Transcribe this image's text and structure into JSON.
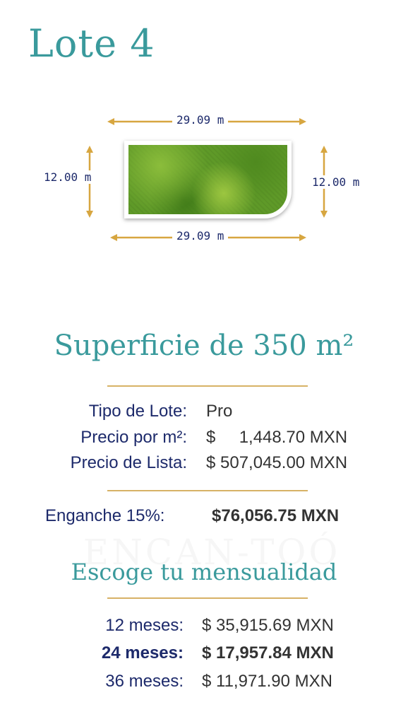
{
  "lot_title": "Lote 4",
  "dimensions": {
    "top": "29.09 m",
    "bottom": "29.09 m",
    "left": "12.00 m",
    "right": "12.00 m"
  },
  "area_title": "Superficie de 350 m²",
  "details": [
    {
      "label": "Tipo de Lote:",
      "value": "Pro"
    },
    {
      "label": "Precio por m²:",
      "value": "$     1,448.70 MXN"
    },
    {
      "label": "Precio de Lista:",
      "value": "$ 507,045.00 MXN"
    }
  ],
  "down_payment": {
    "label": "Enganche 15%:",
    "value": "$76,056.75 MXN"
  },
  "watermark": "ENCAN-TOÓ",
  "choose_title": "Escoge tu mensualidad",
  "plans": [
    {
      "label": "12 meses:",
      "value": "$ 35,915.69 MXN"
    },
    {
      "label": "24 meses:",
      "value": "$ 17,957.84 MXN"
    },
    {
      "label": "36 meses:",
      "value": "$ 11,971.90 MXN"
    }
  ],
  "colors": {
    "teal": "#3a9a9c",
    "navy": "#1d2a6b",
    "gold": "#d7b266"
  }
}
